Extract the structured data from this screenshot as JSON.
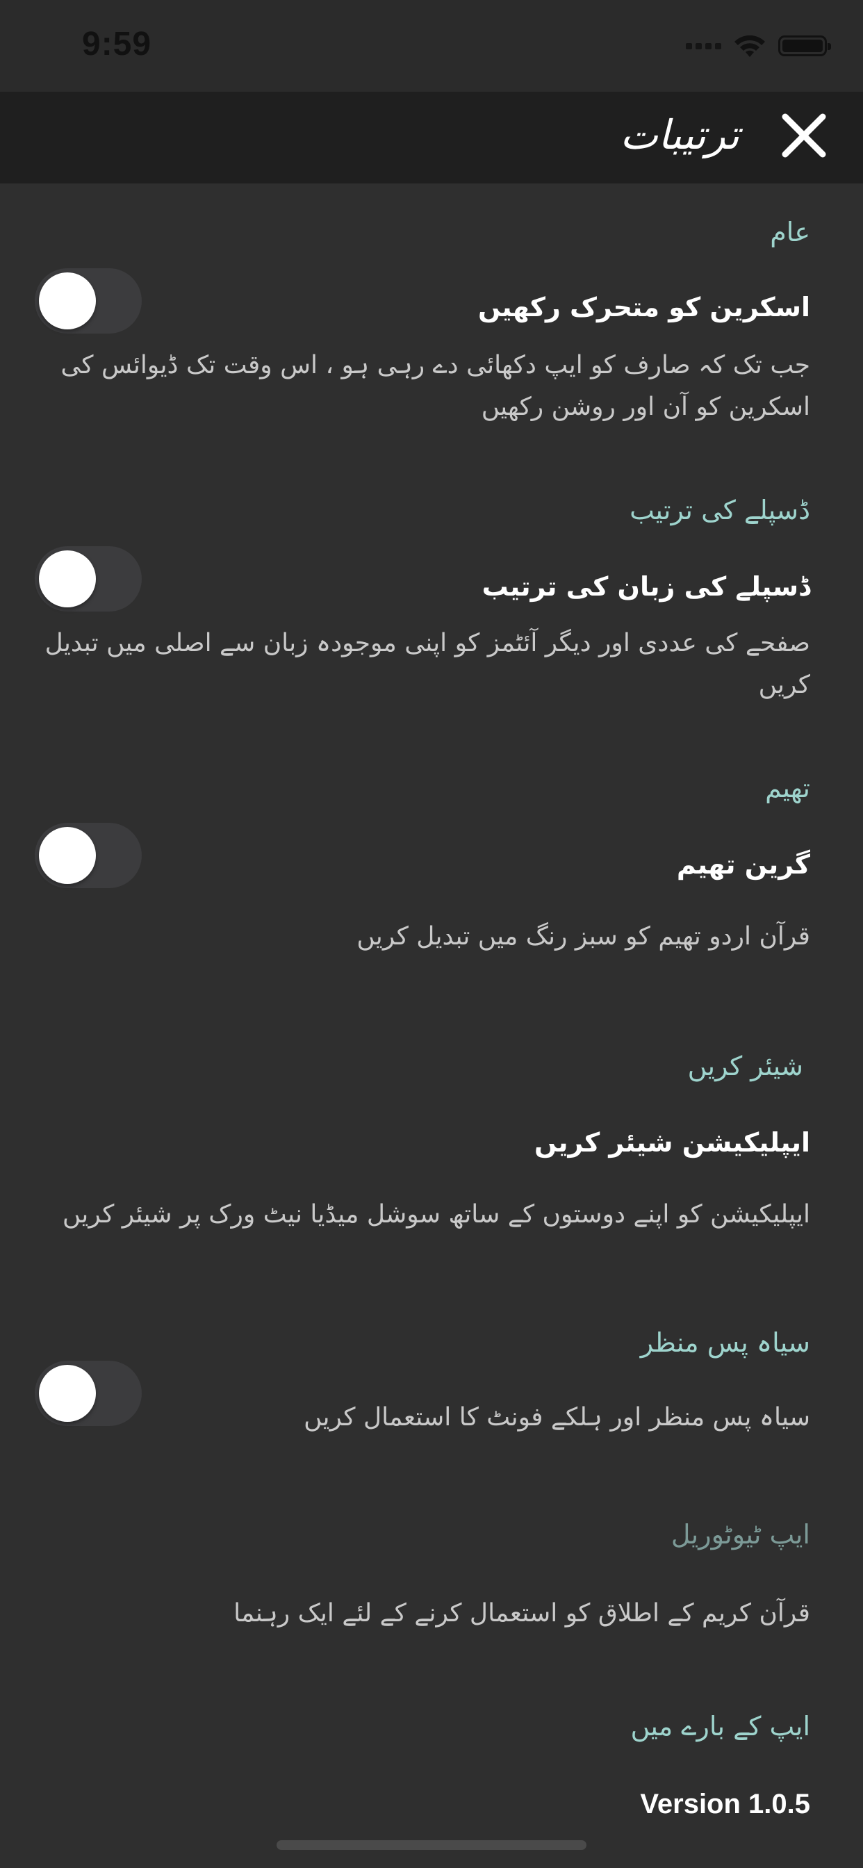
{
  "status_bar": {
    "time": "9:59"
  },
  "nav": {
    "title": "ترتیبات",
    "close_icon": "close-icon"
  },
  "sections": {
    "general": {
      "header": "عام",
      "title": "اسکرین کو متحرک رکھیں",
      "desc": "جب تک کہ صارف کو ایپ دکھائی دے رہی ہو ، اس وقت تک ڈیوائس کی اسکرین کو آن اور روشن رکھیں",
      "toggle_on": false
    },
    "display": {
      "header": "ڈسپلے کی ترتیب",
      "title": "ڈسپلے کی زبان کی ترتیب",
      "desc": "صفحے کی عددی اور دیگر آئٹمز کو اپنی موجودہ زبان سے اصلی میں تبدیل کریں",
      "toggle_on": false
    },
    "theme": {
      "header": "تھیم",
      "title": "گرین تھیم",
      "desc": "قرآن اردو تھیم کو سبز رنگ میں تبدیل کریں",
      "toggle_on": false
    },
    "share": {
      "header": "شیئر کریں",
      "title": "ایپلیکیشن شیئر کریں",
      "desc": "ایپلیکیشن کو اپنے دوستوں کے ساتھ سوشل میڈیا نیٹ ورک پر شیئر کریں"
    },
    "dark": {
      "header": "سیاہ پس منظر",
      "desc": "سیاہ پس منظر اور ہلکے فونٹ کا استعمال کریں",
      "toggle_on": false
    },
    "tutorial": {
      "header": "ایپ ٹیوٹوریل",
      "desc": "قرآن کریم کے اطلاق کو استعمال کرنے کے لئے ایک رہنما"
    },
    "about": {
      "header": "ایپ کے بارے میں",
      "version": "Version 1.0.5"
    }
  },
  "colors": {
    "background": "#2f2f2f",
    "nav": "#1f1f1f",
    "accent": "#9ed4cd"
  }
}
